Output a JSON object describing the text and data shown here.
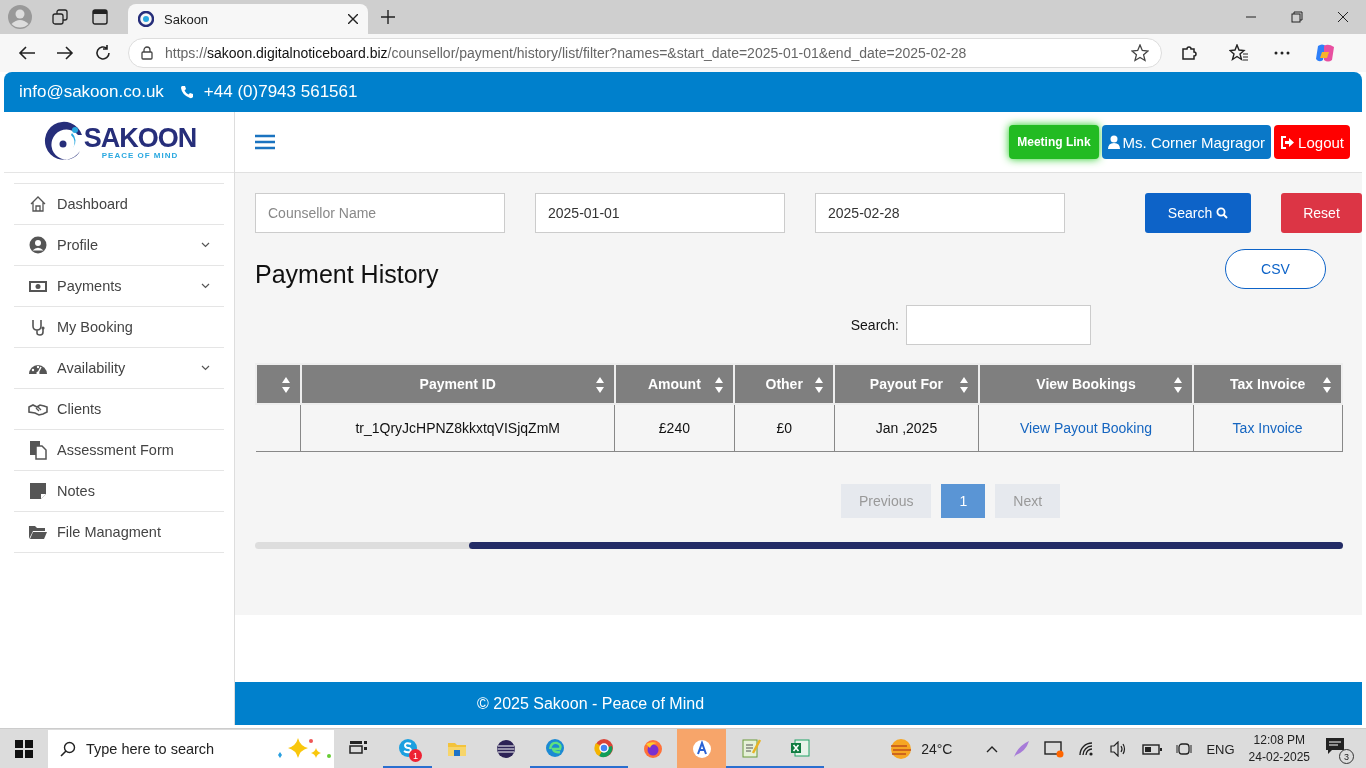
{
  "browser": {
    "tab_title": "Sakoon",
    "url_scheme": "https://",
    "url_host": "sakoon.digitalnoticeboard.biz",
    "url_path": "/counsellor/payment/history/list/filter?names=&start_date=2025-01-01&end_date=2025-02-28"
  },
  "topbar": {
    "email": "info@sakoon.co.uk",
    "phone": "+44 (0)7943 561561"
  },
  "logo": {
    "name": "SAKOON",
    "tagline": "PEACE OF MIND"
  },
  "header_buttons": [
    {
      "kind": "meeting",
      "label": "Meeting Link"
    },
    {
      "kind": "user",
      "label": "Ms. Corner Magragor"
    },
    {
      "kind": "logout",
      "label": "Logout"
    }
  ],
  "sidebar": {
    "items": [
      {
        "label": "Dashboard",
        "expandable": false
      },
      {
        "label": "Profile",
        "expandable": true
      },
      {
        "label": "Payments",
        "expandable": true
      },
      {
        "label": "My Booking",
        "expandable": false
      },
      {
        "label": "Availability",
        "expandable": true
      },
      {
        "label": "Clients",
        "expandable": false
      },
      {
        "label": "Assessment Form",
        "expandable": false
      },
      {
        "label": "Notes",
        "expandable": false
      },
      {
        "label": "File Managment",
        "expandable": false
      }
    ]
  },
  "filters": {
    "counsellor": {
      "placeholder": "Counsellor Name"
    },
    "start_date": {
      "value": "2025-01-01"
    },
    "end_date": {
      "value": "2025-02-28"
    },
    "search_button": "Search",
    "reset_button": "Reset"
  },
  "title": "Payment History",
  "csv_button": "CSV",
  "table_search": {
    "label": "Search:"
  },
  "table": {
    "columns": [
      {
        "sortable": true
      },
      {
        "label": "Payment ID",
        "sortable": true
      },
      {
        "label": "Amount",
        "sortable": true
      },
      {
        "label": "Other",
        "sortable": true
      },
      {
        "label": "Payout For",
        "sortable": true
      },
      {
        "label": "View Bookings",
        "sortable": true
      },
      {
        "label": "Tax Invoice",
        "sortable": true
      }
    ],
    "rows": [
      {
        "cells": [
          {
            "kind": "empty"
          },
          {
            "kind": "text",
            "text": "tr_1QryJcHPNZ8kkxtqVISjqZmM"
          },
          {
            "kind": "text",
            "text": "£240"
          },
          {
            "kind": "text",
            "text": "£0"
          },
          {
            "kind": "text",
            "text": "Jan ,2025"
          },
          {
            "kind": "link",
            "text": "View Payout Booking"
          },
          {
            "kind": "link",
            "text": "Tax Invoice"
          }
        ]
      }
    ]
  },
  "pagination": {
    "previous": {
      "label": "Previous",
      "disabled": true
    },
    "pages": [
      {
        "label": "1",
        "selected": true
      }
    ],
    "next": {
      "label": "Next",
      "disabled": true
    }
  },
  "footer": "© 2025 Sakoon - Peace of Mind",
  "taskbar": {
    "search_placeholder": "Type here to search",
    "apps": [
      {
        "running": false,
        "selected": false
      },
      {
        "running": true,
        "selected": false,
        "badge": "1"
      },
      {
        "running": false,
        "selected": false
      },
      {
        "running": false,
        "selected": false
      },
      {
        "running": true,
        "selected": false
      },
      {
        "running": true,
        "selected": false
      },
      {
        "running": false,
        "selected": false
      },
      {
        "running": false,
        "selected": true
      },
      {
        "running": true,
        "selected": false
      },
      {
        "running": true,
        "selected": false
      }
    ],
    "weather": "24°C",
    "language": "ENG",
    "time": "12:08 PM",
    "date": "24-02-2025",
    "notifications": "3"
  }
}
